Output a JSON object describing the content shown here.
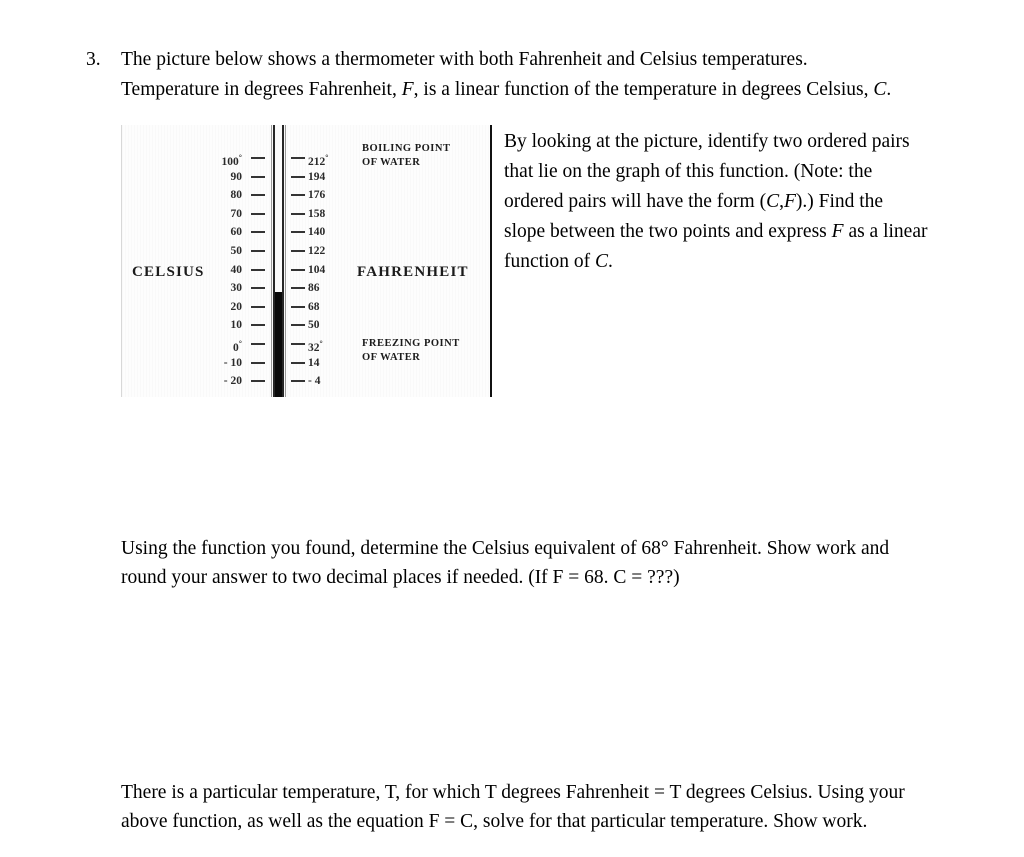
{
  "problem": {
    "number": "3.",
    "intro_line1": "The picture below shows a thermometer with both Fahrenheit and Celsius temperatures.",
    "intro_line2_a": "Temperature in degrees Fahrenheit, ",
    "intro_line2_F": "F",
    "intro_line2_b": ", is a linear function of the temperature in degrees Celsius, ",
    "intro_line2_C": "C",
    "intro_line2_c": "."
  },
  "figure": {
    "celsius_label": "CELSIUS",
    "fahrenheit_label": "FAHRENHEIT",
    "boiling_label_line1": "BOILING POINT",
    "boiling_label_line2": "OF WATER",
    "freezing_label_line1": "FREEZING POINT",
    "freezing_label_line2": "OF WATER",
    "mercury_level_celsius": 28,
    "scale_rows": [
      {
        "celsius": "100",
        "celsius_degree": true,
        "fahrenheit": "212",
        "fahrenheit_degree": true
      },
      {
        "celsius": "90",
        "celsius_degree": false,
        "fahrenheit": "194",
        "fahrenheit_degree": false
      },
      {
        "celsius": "80",
        "celsius_degree": false,
        "fahrenheit": "176",
        "fahrenheit_degree": false
      },
      {
        "celsius": "70",
        "celsius_degree": false,
        "fahrenheit": "158",
        "fahrenheit_degree": false
      },
      {
        "celsius": "60",
        "celsius_degree": false,
        "fahrenheit": "140",
        "fahrenheit_degree": false
      },
      {
        "celsius": "50",
        "celsius_degree": false,
        "fahrenheit": "122",
        "fahrenheit_degree": false
      },
      {
        "celsius": "40",
        "celsius_degree": false,
        "fahrenheit": "104",
        "fahrenheit_degree": false
      },
      {
        "celsius": "30",
        "celsius_degree": false,
        "fahrenheit": "86",
        "fahrenheit_degree": false
      },
      {
        "celsius": "20",
        "celsius_degree": false,
        "fahrenheit": "68",
        "fahrenheit_degree": false
      },
      {
        "celsius": "10",
        "celsius_degree": false,
        "fahrenheit": "50",
        "fahrenheit_degree": false
      },
      {
        "celsius": "0",
        "celsius_degree": true,
        "fahrenheit": "32",
        "fahrenheit_degree": true
      },
      {
        "celsius": "- 10",
        "celsius_degree": false,
        "fahrenheit": "14",
        "fahrenheit_degree": false
      },
      {
        "celsius": "- 20",
        "celsius_degree": false,
        "fahrenheit": "- 4",
        "fahrenheit_degree": false
      }
    ]
  },
  "side_text": {
    "line1": "By looking at the picture, identify two ordered pairs",
    "line2": "that lie on the graph of this function.  (Note:  the",
    "line3_a": "ordered pairs will have the form (",
    "line3_C": "C",
    "line3_comma": ",",
    "line3_F": "F",
    "line3_b": ").)   Find the",
    "line4_a": "slope between the two points and express ",
    "line4_F": "F",
    "line4_b": " as a linear",
    "line5_a": "function of ",
    "line5_C": "C",
    "line5_b": "."
  },
  "question_b": {
    "line1": "Using the function you found, determine the Celsius equivalent of 68° Fahrenheit. Show work and",
    "line2": "round your answer to two decimal places if needed. (If F = 68. C = ???)"
  },
  "question_c": {
    "line1": "There is a particular temperature, T, for which T degrees Fahrenheit = T degrees Celsius.  Using your",
    "line2": "above function, as well as the equation F = C, solve for that particular temperature. Show work."
  }
}
